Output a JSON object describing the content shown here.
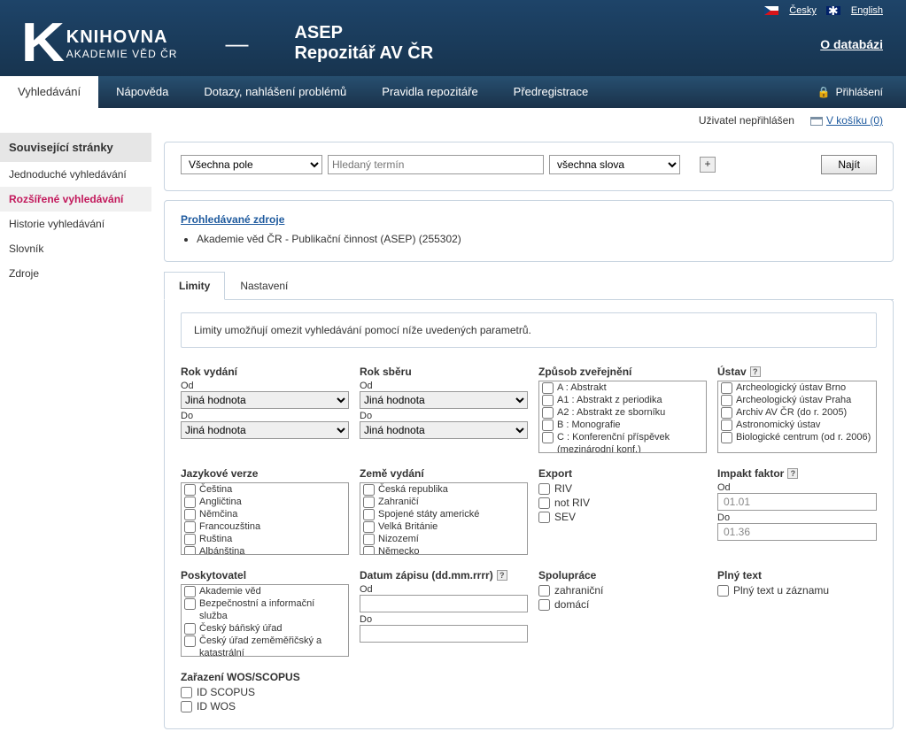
{
  "header": {
    "lang_cz": "Česky",
    "lang_en": "English",
    "about": "O databázi",
    "logo_line1": "KNIHOVNA",
    "logo_line2": "AKADEMIE VĚD ČR",
    "title_line1": "ASEP",
    "title_line2": "Repozitář AV ČR"
  },
  "nav": {
    "items": [
      "Vyhledávání",
      "Nápověda",
      "Dotazy, nahlášení problémů",
      "Pravidla repozitáře",
      "Předregistrace"
    ],
    "login": "Přihlášení"
  },
  "userbar": {
    "status": "Uživatel nepřihlášen",
    "basket": "V košíku (0)"
  },
  "sidebar": {
    "heading": "Související stránky",
    "items": [
      "Jednoduché vyhledávání",
      "Rozšířené vyhledávání",
      "Historie vyhledávání",
      "Slovník",
      "Zdroje"
    ]
  },
  "search": {
    "field": "Všechna pole",
    "placeholder": "Hledaný termín",
    "match": "všechna slova",
    "find": "Najít"
  },
  "sources": {
    "link": "Prohledávané zdroje",
    "item": "Akademie věd ČR - Publikační činnost (ASEP) (255302)"
  },
  "tabs": {
    "t1": "Limity",
    "t2": "Nastavení"
  },
  "info": "Limity umožňují omezit vyhledávání pomocí níže uvedených parametrů.",
  "filters": {
    "rok_vydani": {
      "label": "Rok vydání",
      "od": "Od",
      "do": "Do",
      "val": "Jiná hodnota"
    },
    "rok_sberu": {
      "label": "Rok sběru",
      "od": "Od",
      "do": "Do",
      "val": "Jiná hodnota"
    },
    "zpusob": {
      "label": "Způsob zveřejnění",
      "opts": [
        "A : Abstrakt",
        "A1 : Abstrakt z periodika",
        "A2 : Abstrakt ze sborníku",
        "B : Monografie",
        "C : Konferenční příspěvek (mezinárodní konf.)"
      ]
    },
    "ustav": {
      "label": "Ústav",
      "opts": [
        "Archeologický ústav Brno",
        "Archeologický ústav Praha",
        "Archiv AV ČR (do r. 2005)",
        "Astronomický ústav",
        "Biologické centrum (od r. 2006)"
      ]
    },
    "jazyk": {
      "label": "Jazykové verze",
      "opts": [
        "Čeština",
        "Angličtina",
        "Němčina",
        "Francouzština",
        "Ruština",
        "Albánština"
      ]
    },
    "zeme": {
      "label": "Země vydání",
      "opts": [
        "Česká republika",
        "Zahraničí",
        "Spojené státy americké",
        "Velká Británie",
        "Nizozemí",
        "Německo"
      ]
    },
    "export": {
      "label": "Export",
      "opts": [
        "RIV",
        "not RIV",
        "SEV"
      ]
    },
    "impakt": {
      "label": "Impakt faktor",
      "od": "Od",
      "do": "Do",
      "v1": "01.01",
      "v2": "01.36"
    },
    "poskyt": {
      "label": "Poskytovatel",
      "opts": [
        "Akademie věd",
        "Bezpečnostní a informační služba",
        "Český báňský úřad",
        "Český úřad zeměměřičský a katastrální"
      ]
    },
    "datum": {
      "label": "Datum zápisu (dd.mm.rrrr)",
      "od": "Od",
      "do": "Do"
    },
    "spolup": {
      "label": "Spolupráce",
      "opts": [
        "zahraniční",
        "domácí"
      ]
    },
    "plny": {
      "label": "Plný text",
      "opt": "Plný text u záznamu"
    },
    "wos": {
      "label": "Zařazení WOS/SCOPUS",
      "opts": [
        "ID SCOPUS",
        "ID WOS"
      ]
    }
  }
}
